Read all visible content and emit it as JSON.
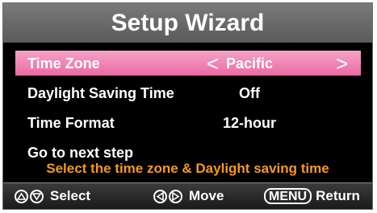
{
  "title": "Setup Wizard",
  "settings": [
    {
      "label": "Time Zone",
      "value": "Pacific",
      "selected": true
    },
    {
      "label": "Daylight Saving Time",
      "value": "Off"
    },
    {
      "label": "Time Format",
      "value": "12-hour"
    },
    {
      "label": "Go to next step",
      "value": ""
    }
  ],
  "arrows": {
    "left": "<",
    "right": ">"
  },
  "hint": "Select the time zone & Daylight saving time",
  "footer": {
    "select_label": "Select",
    "move_label": "Move",
    "menu_key": "MENU",
    "return_label": "Return"
  },
  "colors": {
    "highlight": "#ea6aa2",
    "hint_text": "#f39a20",
    "title_bar": "#6b6b6b"
  },
  "icons": [
    "up-arrow-icon",
    "down-arrow-icon",
    "left-arrow-icon",
    "right-arrow-icon"
  ]
}
